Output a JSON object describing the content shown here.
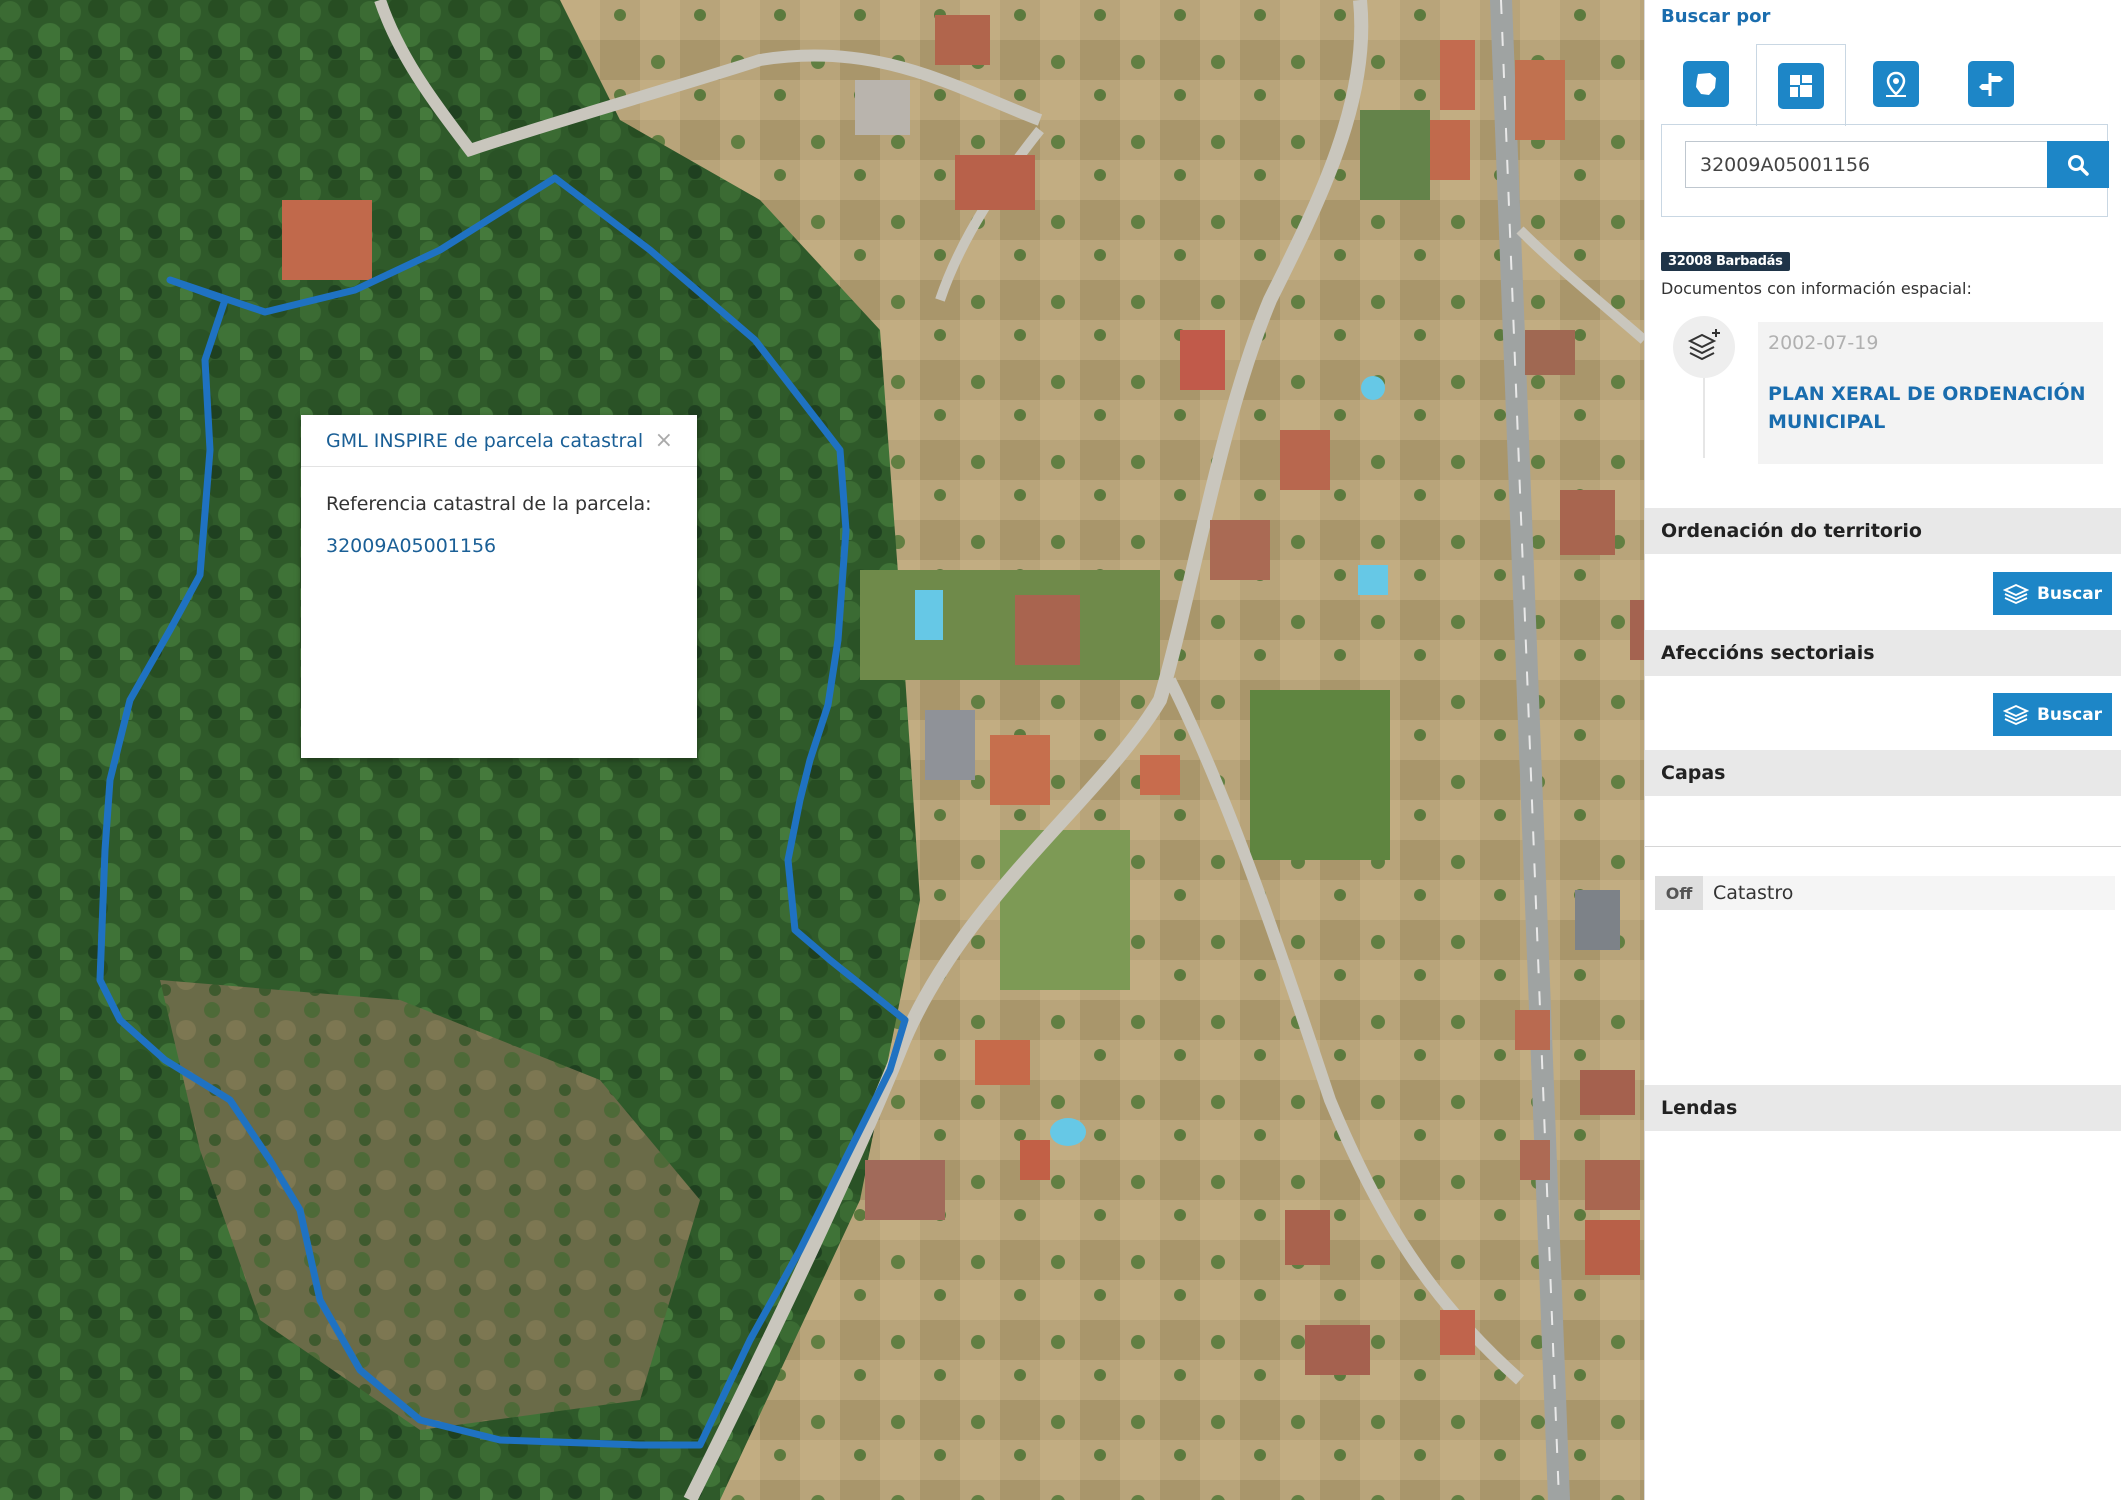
{
  "popup": {
    "title": "GML INSPIRE de parcela catastral",
    "close_icon": "×",
    "label": "Referencia catastral de la parcela:",
    "reference": "32009A05001156"
  },
  "panel": {
    "search_by_label": "Buscar por",
    "tabs": [
      {
        "icon": "galicia-map-icon"
      },
      {
        "icon": "parcel-icon"
      },
      {
        "icon": "location-pin-icon"
      },
      {
        "icon": "signpost-icon"
      }
    ],
    "search": {
      "value": "32009A05001156",
      "button_icon": "search-icon"
    },
    "municipality_badge": "32008 Barbadás",
    "documents_label": "Documentos con información espacial:",
    "document": {
      "date": "2002-07-19",
      "title": "PLAN XERAL DE ORDENACIÓN MUNICIPAL"
    },
    "sections": {
      "ordenacion": "Ordenación do territorio",
      "afeccions": "Afeccións sectoriais",
      "capas": "Capas",
      "lendas": "Lendas"
    },
    "buscar_label": "Buscar",
    "layer": {
      "toggle": "Off",
      "name": "Catastro"
    }
  },
  "colors": {
    "accent": "#1d86c7",
    "link": "#1a5f96",
    "parcel_outline": "#1f72c2"
  }
}
